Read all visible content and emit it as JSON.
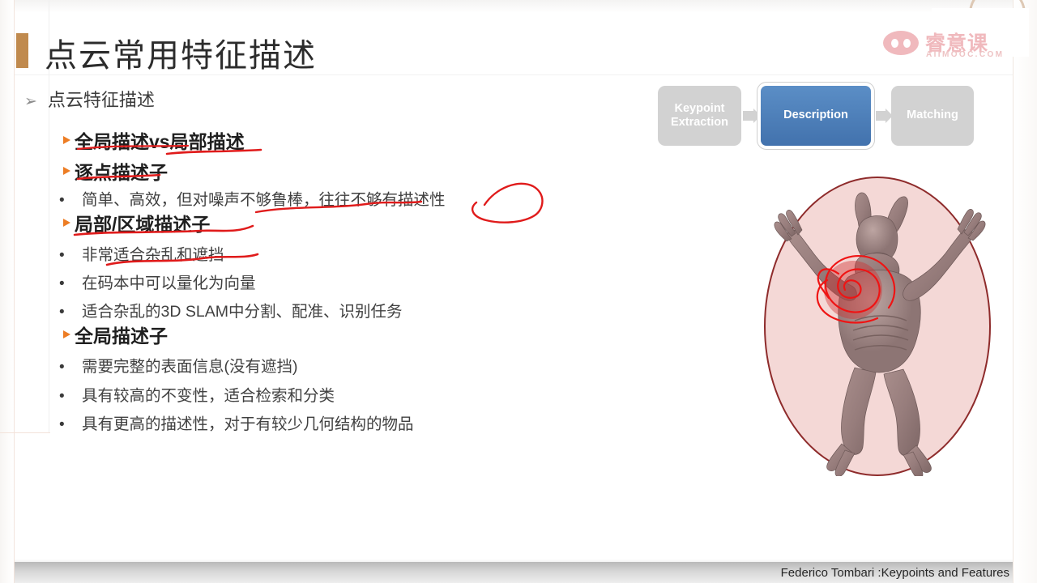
{
  "slide": {
    "title": "点云常用特征描述",
    "accent_color": "#c08a4e",
    "outline_marker": "➢",
    "outline_heading": "点云特征描述"
  },
  "sections": [
    {
      "marker": "►",
      "label": "全局描述vs局部描述"
    },
    {
      "marker": "►",
      "label": "逐点描述子"
    },
    {
      "marker": "►",
      "label": "局部/区域描述子"
    },
    {
      "marker": "►",
      "label": "全局描述子"
    }
  ],
  "bullets": {
    "pointwise": [
      {
        "dot": "•",
        "text": "简单、高效，但对噪声不够鲁棒，往往不够有描述性"
      }
    ],
    "local": [
      {
        "dot": "•",
        "text": "非常适合杂乱和遮挡"
      },
      {
        "dot": "•",
        "text": "在码本中可以量化为向量"
      },
      {
        "dot": "•",
        "text": "适合杂乱的3D SLAM中分割、配准、识别任务"
      }
    ],
    "global": [
      {
        "dot": "•",
        "text": "需要完整的表面信息(没有遮挡)"
      },
      {
        "dot": "•",
        "text": "具有较高的不变性，适合检索和分类"
      },
      {
        "dot": "•",
        "text": "具有更高的描述性，对于有较少几何结构的物品"
      }
    ]
  },
  "pipeline": {
    "steps": [
      {
        "label": "Keypoint Extraction",
        "state": "inactive",
        "color": "#d2d2d2"
      },
      {
        "label": "Description",
        "state": "active",
        "color": "#4a7ebb"
      },
      {
        "label": "Matching",
        "state": "inactive",
        "color": "#d2d2d2"
      }
    ]
  },
  "logo": {
    "cn": "睿意课",
    "en": "AIIMOOC.COM",
    "color": "#f0b9bd"
  },
  "figure": {
    "caption": "",
    "subject": "armadillo-3d-model",
    "highlight_color": "#e02020",
    "ellipse_border_color": "#8e2b2b",
    "ellipse_fill_color": "#f4d8d6"
  },
  "annotations": {
    "ink_color": "#e01b1b",
    "marks": [
      "underline-global-vs-local",
      "underline-pointwise",
      "underline-local-region",
      "underline-clutter-occlusion",
      "circle-descriptiveness",
      "spiral-on-model-chest",
      "ellipse-around-model"
    ]
  },
  "footer": {
    "credit": "Federico Tombari :Keypoints and Features"
  }
}
